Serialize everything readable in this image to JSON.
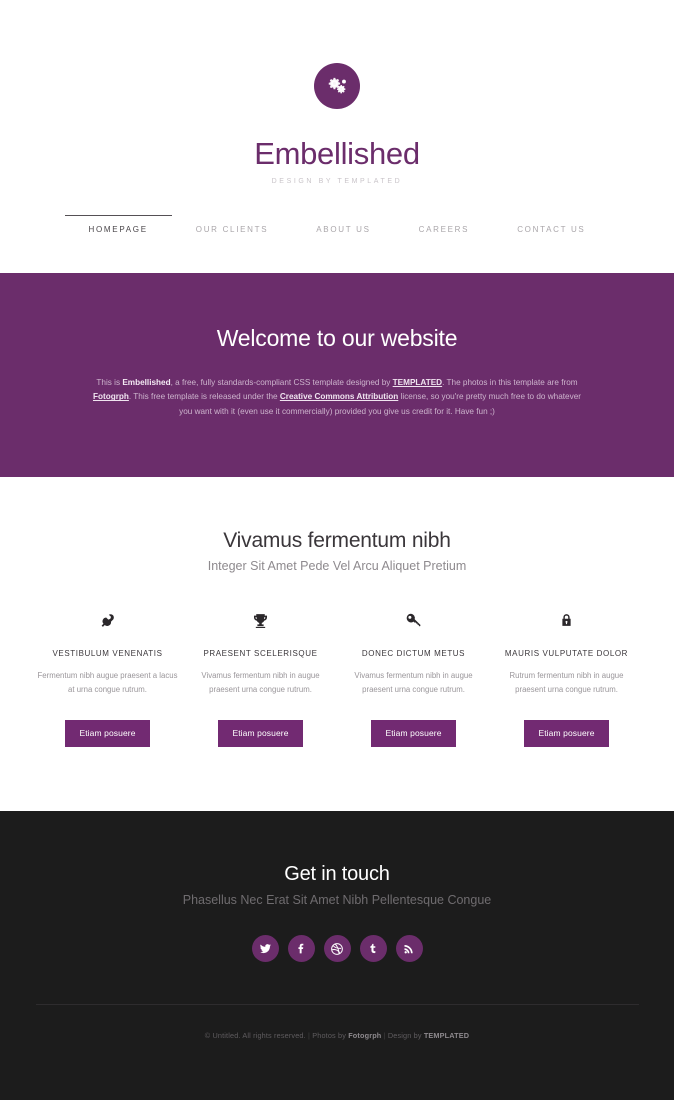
{
  "header": {
    "logo_icon": "cogs-icon",
    "title": "Embellished",
    "tagline": "DESIGN BY TEMPLATED",
    "nav": [
      {
        "label": "HOMEPAGE",
        "active": true
      },
      {
        "label": "OUR CLIENTS",
        "active": false
      },
      {
        "label": "ABOUT US",
        "active": false
      },
      {
        "label": "CAREERS",
        "active": false
      },
      {
        "label": "CONTACT US",
        "active": false
      }
    ]
  },
  "banner": {
    "heading": "Welcome to our website",
    "text_1a": "This is ",
    "text_1b": "Embellished",
    "text_1c": ", a free, fully standards-compliant CSS template designed by ",
    "link_templated": "TEMPLATED",
    "text_1d": ". The photos in this template are from ",
    "link_fotogrph": "Fotogrph",
    "text_1e": ". This free template is released under the ",
    "link_cc": "Creative Commons Attribution",
    "text_1f": " license, so you're pretty much free to do whatever you want with it (even use it commercially) provided you give us credit for it. Have fun ;)"
  },
  "features": {
    "heading": "Vivamus fermentum nibh",
    "subheading": "Integer Sit Amet Pede Vel Arcu Aliquet Pretium",
    "columns": [
      {
        "icon": "wrench-icon",
        "title": "VESTIBULUM VENENATIS",
        "description": "Fermentum nibh augue praesent a lacus at urna congue rutrum.",
        "button": "Etiam posuere"
      },
      {
        "icon": "trophy-icon",
        "title": "PRAESENT SCELERISQUE",
        "description": "Vivamus fermentum nibh in augue praesent urna congue rutrum.",
        "button": "Etiam posuere"
      },
      {
        "icon": "key-icon",
        "title": "DONEC DICTUM METUS",
        "description": "Vivamus fermentum nibh in augue praesent urna congue rutrum.",
        "button": "Etiam posuere"
      },
      {
        "icon": "lock-icon",
        "title": "MAURIS VULPUTATE DOLOR",
        "description": "Rutrum fermentum nibh in augue praesent urna congue rutrum.",
        "button": "Etiam posuere"
      }
    ]
  },
  "footer": {
    "heading": "Get in touch",
    "subheading": "Phasellus Nec Erat Sit Amet Nibh Pellentesque Congue",
    "social": [
      {
        "name": "twitter-icon",
        "label": "Twitter"
      },
      {
        "name": "facebook-icon",
        "label": "Facebook"
      },
      {
        "name": "dribbble-icon",
        "label": "Dribbble"
      },
      {
        "name": "tumblr-icon",
        "label": "Tumblr"
      },
      {
        "name": "rss-icon",
        "label": "RSS"
      }
    ],
    "copyright_1": "© Untitled. All rights reserved.",
    "copyright_sep_1": " | ",
    "copyright_2": "Photos by ",
    "copyright_photos_by": "Fotogrph",
    "copyright_sep_2": " | ",
    "copyright_3": "Design by ",
    "copyright_design_by": "TEMPLATED"
  },
  "colors": {
    "brand_purple": "#6B2D6B",
    "button_purple": "#722A72",
    "footer_dark": "#1C1C1C",
    "text_dark": "#3a363a",
    "text_muted": "#9a969a"
  }
}
